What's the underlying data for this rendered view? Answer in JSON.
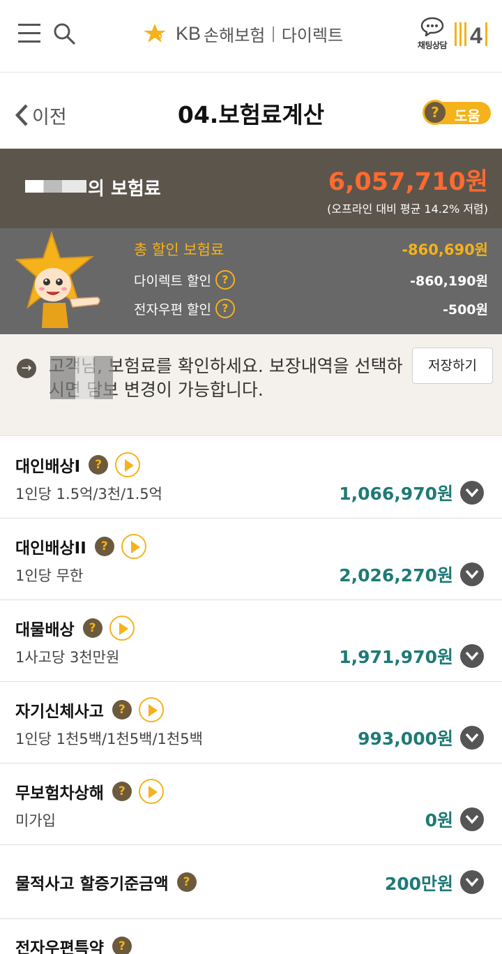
{
  "header": {
    "brand_kb": "KB",
    "brand_name": "손해보험",
    "brand_sep": "|",
    "brand_direct": "다이렉트",
    "chat_label": "채팅상담",
    "logo_text": "4"
  },
  "titlebar": {
    "back_label": "이전",
    "page_title": "04.보험료계산",
    "help_label": "도움",
    "help_q": "?"
  },
  "premium": {
    "label": "의 보험료",
    "amount": "6,057,710원",
    "note": "(오프라인 대비 평균 14.2% 저렴)"
  },
  "discount": {
    "total_label": "총 할인 보험료",
    "total_value": "-860,690원",
    "items": [
      {
        "label": "다이렉트 할인",
        "value": "-860,190원"
      },
      {
        "label": "전자우편 할인",
        "value": "-500원"
      }
    ]
  },
  "notice": {
    "arrow": "→",
    "text": "고객님, 보험료를 확인하세요. 보장내역을 선택하시면 담보 변경이 가능합니다.",
    "save_label": "저장하기"
  },
  "coverages": [
    {
      "title": "대인배상I",
      "sub": "1인당 1.5억/3천/1.5억",
      "amount": "1,066,970원"
    },
    {
      "title": "대인배상II",
      "sub": "1인당 무한",
      "amount": "2,026,270원"
    },
    {
      "title": "대물배상",
      "sub": "1사고당 3천만원",
      "amount": "1,971,970원"
    },
    {
      "title": "자기신체사고",
      "sub": "1인당 1천5백/1천5백/1천5백",
      "amount": "993,000원"
    },
    {
      "title": "무보험차상해",
      "sub": "미가입",
      "amount": "0원"
    },
    {
      "title": "물적사고 할증기준금액",
      "amount": "200만원"
    },
    {
      "title": "전자우편특약"
    }
  ],
  "colors": {
    "accent": "#f5b21a",
    "premium_amount": "#ff6a2f",
    "coverage_amount": "#1e7a76",
    "summary_bg": "#5c554c"
  }
}
